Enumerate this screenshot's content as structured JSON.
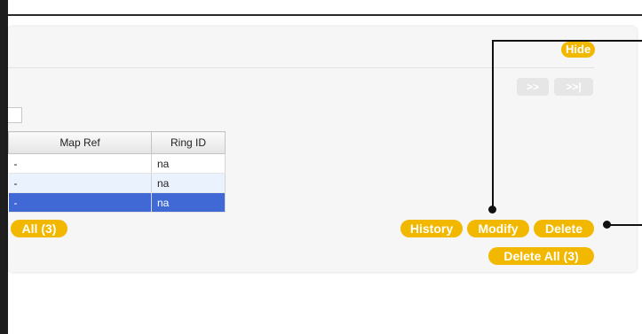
{
  "buttons": {
    "hide": "Hide",
    "next": ">>",
    "last": ">>|",
    "select_all": "All (3)",
    "history": "History",
    "modify": "Modify",
    "delete": "Delete",
    "delete_all": "Delete All (3)"
  },
  "table": {
    "columns": [
      "Map Ref",
      "Ring ID"
    ],
    "rows": [
      {
        "map_ref": "-",
        "ring_id": "na",
        "selected": false
      },
      {
        "map_ref": "-",
        "ring_id": "na",
        "selected": false
      },
      {
        "map_ref": "-",
        "ring_id": "na",
        "selected": true
      }
    ]
  },
  "colors": {
    "accent": "#f2b800",
    "selected_row": "#4169d6",
    "alt_row": "#eaf3fd"
  }
}
